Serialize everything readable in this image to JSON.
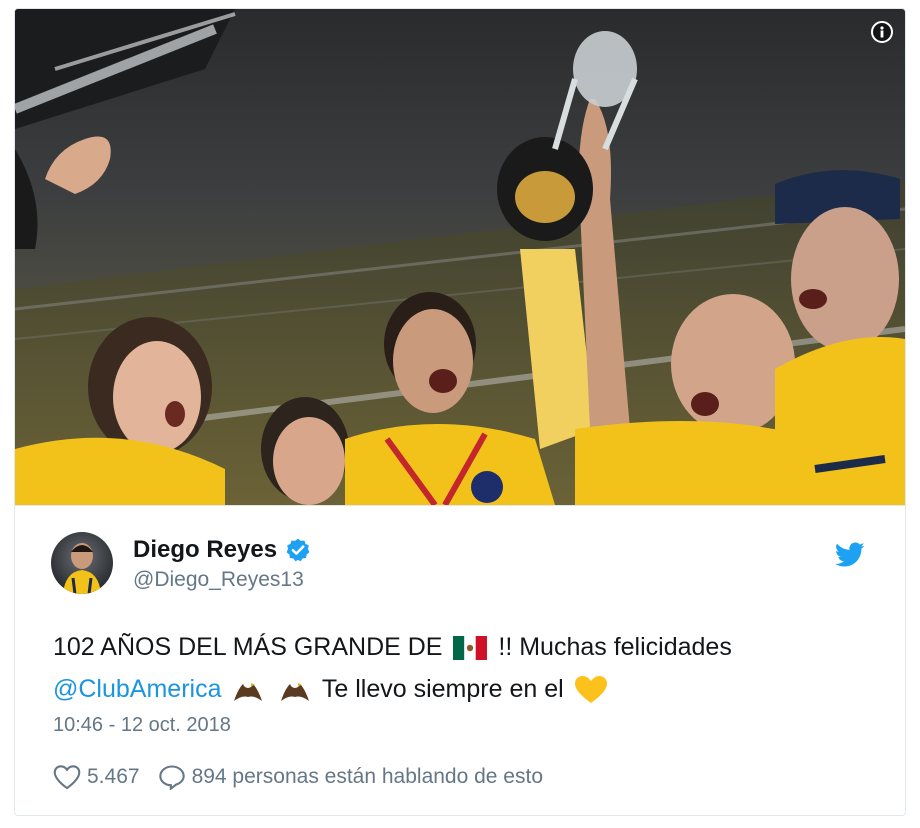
{
  "tweet": {
    "author_name": "Diego Reyes",
    "author_handle": "@Diego_Reyes13",
    "text_part1": "102 AÑOS DEL MÁS GRANDE DE",
    "text_part2": "!! Muchas felicidades",
    "mention": "@ClubAmerica",
    "text_part3": "Te llevo siempre en el",
    "timestamp": "10:46 - 12 oct. 2018",
    "likes": "5.467",
    "conversation": "894 personas están hablando de esto"
  },
  "icons": {
    "info": "info-icon",
    "verified": "verified-badge-icon",
    "twitter": "twitter-bird-icon",
    "flag": "mexico-flag-emoji",
    "eagle": "eagle-emoji",
    "heart": "yellow-heart-emoji",
    "like": "heart-outline-icon",
    "reply": "speech-bubble-icon"
  },
  "colors": {
    "link": "#1b95e0",
    "verified": "#1da1f2",
    "muted": "#657786",
    "text": "#14171a",
    "jersey_yellow": "#f2c21a"
  }
}
